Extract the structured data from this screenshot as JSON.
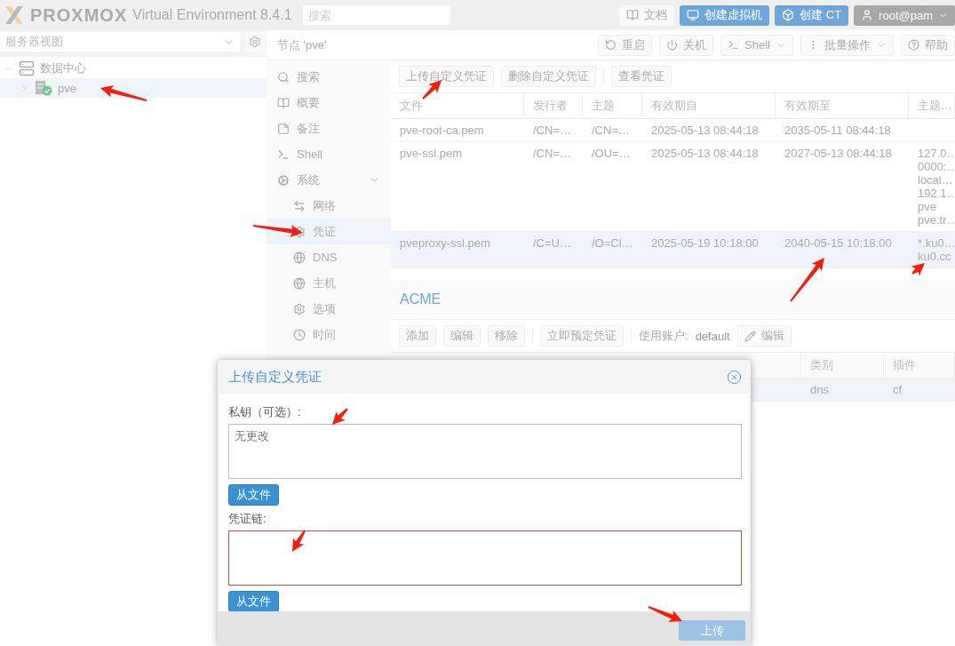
{
  "header": {
    "brand": "PROXMOX",
    "product": "Virtual Environment 8.4.1",
    "search": {
      "placeholder": "搜索"
    },
    "buttons": [
      {
        "label": "文档",
        "kind": "plain"
      },
      {
        "label": "创建虚拟机",
        "kind": "primary"
      },
      {
        "label": "创建 CT",
        "kind": "primary"
      },
      {
        "label": "root@pam",
        "kind": "user"
      }
    ]
  },
  "sidebar": {
    "view_select": "服务器视图",
    "tree": [
      {
        "label": "数据中心",
        "expanded": true,
        "selected": false,
        "children": [
          {
            "label": "pve",
            "expanded": false,
            "selected": true
          }
        ]
      }
    ]
  },
  "node": {
    "title": "节点 'pve'",
    "toolbar": [
      {
        "label": "重启",
        "menu": false
      },
      {
        "label": "关机",
        "menu": false
      },
      {
        "label": "Shell",
        "menu": true
      },
      {
        "label": "批量操作",
        "menu": true
      },
      {
        "label": "帮助",
        "menu": false
      }
    ]
  },
  "nav": [
    {
      "label": "搜索",
      "selected": false
    },
    {
      "label": "概要",
      "selected": false
    },
    {
      "label": "备注",
      "selected": false
    },
    {
      "label": "Shell",
      "selected": false
    },
    {
      "label": "系统",
      "selected": false,
      "expanded": true,
      "children": [
        {
          "label": "网络",
          "selected": false
        },
        {
          "label": "凭证",
          "selected": true
        },
        {
          "label": "DNS",
          "selected": false
        },
        {
          "label": "主机",
          "selected": false
        },
        {
          "label": "选项",
          "selected": false
        },
        {
          "label": "时间",
          "selected": false
        }
      ]
    }
  ],
  "certificates": {
    "toolbar": [
      "上传自定义凭证",
      "删除自定义凭证",
      "查看凭证"
    ],
    "columns": [
      "文件",
      "发行者",
      "主题",
      "有效期自",
      "有效期至",
      "主题…"
    ],
    "rows": [
      {
        "selected": false,
        "cells": [
          "pve-root-ca.pem",
          "/CN=…",
          "/CN=…",
          "2025-05-13 08:44:18",
          "2035-05-11 08:44:18"
        ],
        "names": []
      },
      {
        "selected": false,
        "cells": [
          "pve-ssl.pem",
          "/CN=…",
          "/OU=…",
          "2025-05-13 08:44:18",
          "2027-05-13 08:44:18"
        ],
        "names": [
          "127.0…",
          "0000:…",
          "local…",
          "192.1…",
          "pve",
          "pve.tr…"
        ]
      },
      {
        "selected": true,
        "cells": [
          "pveproxy-ssl.pem",
          "/C=U…",
          "/O=Cl…",
          "2025-05-19 10:18:00",
          "2040-05-15 10:18:00"
        ],
        "names": [
          "*.ku0…",
          "ku0.cc"
        ]
      }
    ]
  },
  "acme": {
    "title": "ACME",
    "toolbar": [
      "添加",
      "编辑",
      "移除",
      "立即预定凭证"
    ],
    "account_label": "使用账户:",
    "account": "default",
    "account_edit": "编辑",
    "columns": [
      "类别",
      "插件"
    ],
    "rows": [
      {
        "selected": true,
        "cells": [
          "dns",
          "cf"
        ]
      }
    ]
  },
  "dialog": {
    "title": "上传自定义凭证",
    "fields": [
      {
        "label": "私钥（可选）:",
        "placeholder": "无更改",
        "invalid": false,
        "button": "从文件"
      },
      {
        "label": "凭证链:",
        "invalid": true,
        "button": "从文件"
      }
    ],
    "submit": {
      "label": "上传",
      "disabled": true
    }
  }
}
